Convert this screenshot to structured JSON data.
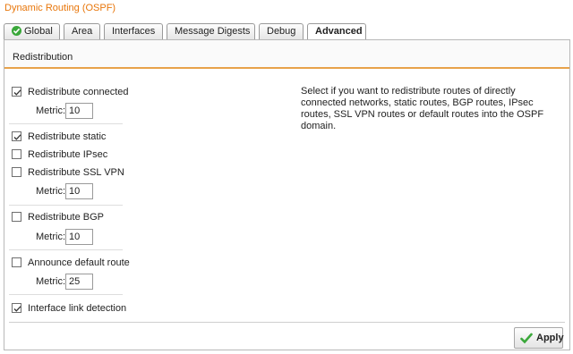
{
  "window": {
    "title": "Dynamic Routing (OSPF)"
  },
  "tabs": [
    {
      "label": "Global",
      "icon": "green-check-circle-icon"
    },
    {
      "label": "Area"
    },
    {
      "label": "Interfaces"
    },
    {
      "label": "Message Digests"
    },
    {
      "label": "Debug"
    },
    {
      "label": "Advanced",
      "active": true
    }
  ],
  "section": {
    "title": "Redistribution"
  },
  "options": {
    "connected": {
      "label": "Redistribute connected",
      "checked": true,
      "metric_label": "Metric:",
      "metric_value": "10"
    },
    "static": {
      "label": "Redistribute static",
      "checked": true
    },
    "ipsec": {
      "label": "Redistribute IPsec",
      "checked": false
    },
    "sslvpn": {
      "label": "Redistribute SSL VPN",
      "checked": false,
      "metric_label": "Metric:",
      "metric_value": "10"
    },
    "bgp": {
      "label": "Redistribute BGP",
      "checked": false,
      "metric_label": "Metric:",
      "metric_value": "10"
    },
    "default_route": {
      "label": "Announce default route",
      "checked": false,
      "metric_label": "Metric:",
      "metric_value": "25"
    },
    "link_detection": {
      "label": "Interface link detection",
      "checked": true
    }
  },
  "help_text": "Select if you want to redistribute routes of directly connected networks, static routes, BGP routes, IPsec routes, SSL VPN routes or default routes into the OSPF domain.",
  "actions": {
    "apply_label": "Apply",
    "apply_icon": "green-check-icon"
  },
  "colors": {
    "title": "#e8760a",
    "section_accent": "#e8a24a",
    "check_green": "#3aa83a"
  }
}
